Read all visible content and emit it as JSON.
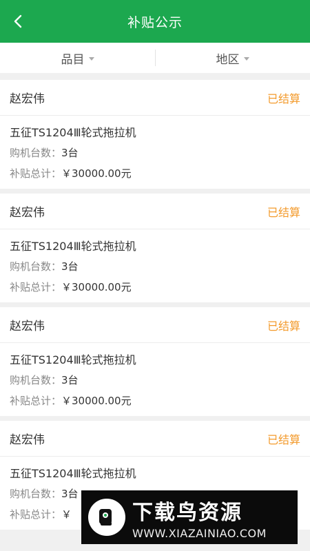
{
  "header": {
    "title": "补贴公示"
  },
  "filters": [
    {
      "label": "品目"
    },
    {
      "label": "地区"
    }
  ],
  "records": [
    {
      "name": "赵宏伟",
      "status": "已结算",
      "product": "五征TS1204Ⅲ轮式拖拉机",
      "qty_label": "购机台数：",
      "qty": "3台",
      "subsidy_label": "补贴总计：",
      "subsidy": "￥30000.00元"
    },
    {
      "name": "赵宏伟",
      "status": "已结算",
      "product": "五征TS1204Ⅲ轮式拖拉机",
      "qty_label": "购机台数：",
      "qty": "3台",
      "subsidy_label": "补贴总计：",
      "subsidy": "￥30000.00元"
    },
    {
      "name": "赵宏伟",
      "status": "已结算",
      "product": "五征TS1204Ⅲ轮式拖拉机",
      "qty_label": "购机台数：",
      "qty": "3台",
      "subsidy_label": "补贴总计：",
      "subsidy": "￥30000.00元"
    },
    {
      "name": "赵宏伟",
      "status": "已结算",
      "product": "五征TS1204Ⅲ轮式拖拉机",
      "qty_label": "购机台数：",
      "qty": "3台",
      "subsidy_label": "补贴总计：",
      "subsidy": "￥"
    }
  ],
  "watermark": {
    "main": "下载鸟资源",
    "url": "WWW.XIAZAINIAO.COM"
  },
  "colors": {
    "header_bg": "#1ca84f",
    "status": "#f39a2b"
  }
}
